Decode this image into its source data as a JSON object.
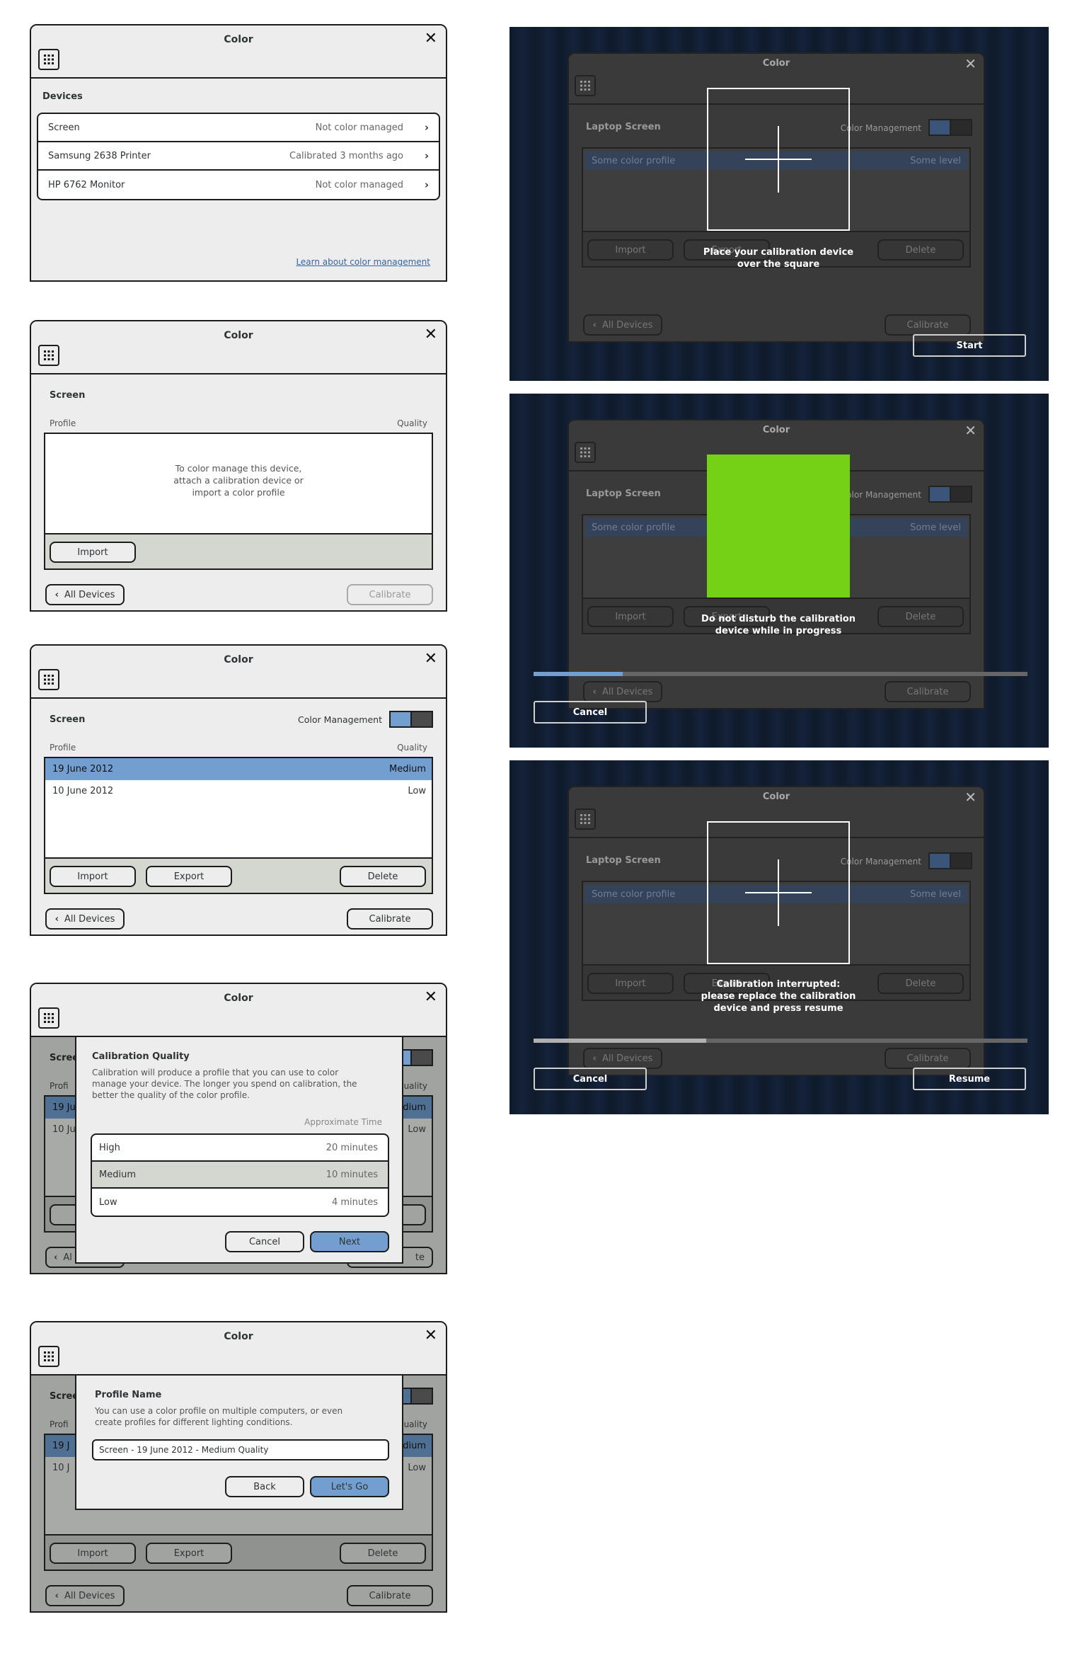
{
  "window_title": "Color",
  "close_glyph": "✕",
  "chevron_right": "›",
  "chevron_left": "‹",
  "colors": {
    "selection_blue": "#729fcf",
    "calibration_green": "#73d216",
    "progress_blue": "#729fcf",
    "progress_gray": "#b0b0b0"
  },
  "panel1": {
    "section": "Devices",
    "devices": [
      {
        "name": "Screen",
        "status": "Not color managed"
      },
      {
        "name": "Samsung 2638 Printer",
        "status": "Calibrated 3 months ago"
      },
      {
        "name": "HP 6762 Monitor",
        "status": "Not color managed"
      }
    ],
    "link": "Learn about color management"
  },
  "panel2": {
    "section": "Screen",
    "col_profile": "Profile",
    "col_quality": "Quality",
    "empty_message_1": "To color manage this device,",
    "empty_message_2": "attach a calibration device or",
    "empty_message_3": "import a color profile",
    "import": "Import",
    "all_devices": "All Devices",
    "calibrate": "Calibrate"
  },
  "panel3": {
    "section": "Screen",
    "color_management": "Color Management",
    "col_profile": "Profile",
    "col_quality": "Quality",
    "profiles": [
      {
        "name": "19 June 2012",
        "quality": "Medium"
      },
      {
        "name": "10 June 2012",
        "quality": "Low"
      }
    ],
    "import": "Import",
    "export": "Export",
    "delete": "Delete",
    "all_devices": "All Devices",
    "calibrate": "Calibrate"
  },
  "panel4": {
    "bg_section": "Scree",
    "bg_profile": "Profi",
    "bg_quality": "uality",
    "bg_row1_left": "19 Ju",
    "bg_row1_right": "edium",
    "bg_row2_left": "10 Ju",
    "bg_row2_right": "Low",
    "bg_all_devices": "Al",
    "bg_calibrate": "te",
    "dialog_title": "Calibration Quality",
    "dialog_text_1": "Calibration will produce a profile that you can use to color",
    "dialog_text_2": "manage your device. The longer you spend on calibration, the",
    "dialog_text_3": "better the quality of the color profile.",
    "approx_time": "Approximate Time",
    "options": [
      {
        "label": "High",
        "time": "20 minutes"
      },
      {
        "label": "Medium",
        "time": "10 minutes"
      },
      {
        "label": "Low",
        "time": "4 minutes"
      }
    ],
    "cancel": "Cancel",
    "next": "Next"
  },
  "panel5": {
    "bg_section": "Scree",
    "bg_profile": "Profi",
    "bg_quality": "uality",
    "bg_row1_left": "19 J",
    "bg_row1_right": "edium",
    "bg_row2_left": "10 J",
    "bg_row2_right": "Low",
    "dialog_title": "Profile Name",
    "dialog_text_1": "You can use a color profile on multiple computers, or even",
    "dialog_text_2": "create profiles for different lighting conditions.",
    "field_value": "Screen - 19 June 2012 - Medium Quality",
    "back": "Back",
    "lets_go": "Let's Go",
    "import": "Import",
    "export": "Export",
    "delete": "Delete",
    "all_devices": "All Devices",
    "calibrate": "Calibrate"
  },
  "ghost": {
    "title": "Color",
    "device": "Laptop Screen",
    "color_management": "Color Management",
    "profile": "Some color profile",
    "level": "Some level",
    "import": "Import",
    "export": "Export",
    "delete": "Delete",
    "all_devices": "All Devices",
    "calibrate": "Calibrate"
  },
  "calib1": {
    "instruction_1": "Place your calibration device",
    "instruction_2": "over the square",
    "start": "Start"
  },
  "calib2": {
    "instruction_1": "Do not disturb the calibration",
    "instruction_2": "device while in progress",
    "progress": 0.18,
    "cancel": "Cancel"
  },
  "calib3": {
    "instruction_1": "Calibration interrupted:",
    "instruction_2": "please replace the calibration",
    "instruction_3": "device and press resume",
    "progress": 0.35,
    "cancel": "Cancel",
    "resume": "Resume"
  }
}
